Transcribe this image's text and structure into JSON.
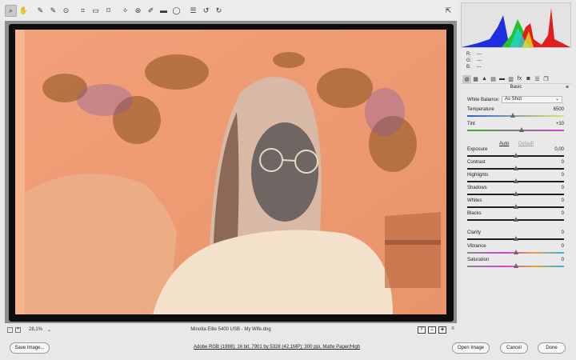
{
  "toolbar": {
    "tools": [
      {
        "name": "zoom-tool",
        "glyph": "⌕",
        "selected": true
      },
      {
        "name": "hand-tool",
        "glyph": "✋"
      },
      {
        "name": "white-balance-tool",
        "glyph": "✎"
      },
      {
        "name": "color-sampler-tool",
        "glyph": "✎"
      },
      {
        "name": "targeted-adjustment-tool",
        "glyph": "⊙"
      },
      {
        "name": "crop-tool",
        "glyph": "⌗"
      },
      {
        "name": "straighten-tool",
        "glyph": "▭"
      },
      {
        "name": "transform-tool",
        "glyph": "⌑"
      },
      {
        "name": "spot-removal-tool",
        "glyph": "✧"
      },
      {
        "name": "red-eye-tool",
        "glyph": "⊛"
      },
      {
        "name": "adjustment-brush-tool",
        "glyph": "✐"
      },
      {
        "name": "graduated-filter-tool",
        "glyph": "▬"
      },
      {
        "name": "radial-filter-tool",
        "glyph": "◯"
      },
      {
        "name": "preferences-tool",
        "glyph": "☰"
      },
      {
        "name": "rotate-left-tool",
        "glyph": "↺"
      },
      {
        "name": "rotate-right-tool",
        "glyph": "↻"
      }
    ],
    "fullscreen_glyph": "⇱"
  },
  "status": {
    "zoom_minus": "-",
    "zoom_plus": "+",
    "zoom": "28,1%",
    "zoom_caret": "⌄",
    "file_info": "Minolta Elite 5400  USB  -  My Wife.dng",
    "view_y": "Y",
    "view_before_after": "⊥",
    "view_toggle": "◈",
    "view_settings": "≡"
  },
  "rgb": {
    "r_label": "R:",
    "r_value": "---",
    "g_label": "G:",
    "g_value": "---",
    "b_label": "B:",
    "b_value": "---"
  },
  "panel": {
    "tabs": [
      "◍",
      "▦",
      "▲",
      "▤",
      "▬",
      "▥",
      "fx",
      "◙",
      "☰",
      "❐"
    ],
    "section_title": "Basic",
    "menu_glyph": "≡",
    "white_balance_label": "White Balance:",
    "white_balance_value": "As Shot",
    "auto_label": "Auto",
    "default_label": "Default",
    "sliders": [
      {
        "key": "temperature",
        "label": "Temperature",
        "value": "6500",
        "pos": 0.47
      },
      {
        "key": "tint",
        "label": "Tint",
        "value": "+10",
        "pos": 0.56
      },
      {
        "key": "exposure",
        "label": "Exposure",
        "value": "0,00",
        "pos": 0.5
      },
      {
        "key": "contrast",
        "label": "Contrast",
        "value": "0",
        "pos": 0.5
      },
      {
        "key": "highlights",
        "label": "Highlights",
        "value": "0",
        "pos": 0.5
      },
      {
        "key": "shadows",
        "label": "Shadows",
        "value": "0",
        "pos": 0.5
      },
      {
        "key": "whites",
        "label": "Whites",
        "value": "0",
        "pos": 0.5
      },
      {
        "key": "blacks",
        "label": "Blacks",
        "value": "0",
        "pos": 0.5
      },
      {
        "key": "clarity",
        "label": "Clarity",
        "value": "0",
        "pos": 0.5
      },
      {
        "key": "vibrance",
        "label": "Vibrance",
        "value": "0",
        "pos": 0.5
      },
      {
        "key": "saturation",
        "label": "Saturation",
        "value": "0",
        "pos": 0.5
      }
    ]
  },
  "footer": {
    "save_image": "Save Image...",
    "workflow_options": "Adobe RGB (1998); 16 bit; 7901 by 5328 (42,1MP); 300 ppi, Matte Paper/High",
    "open_image": "Open Image",
    "cancel": "Cancel",
    "done": "Done"
  },
  "colors": {
    "film_orange": "#f09b73",
    "accent": "#2b5fd9"
  }
}
